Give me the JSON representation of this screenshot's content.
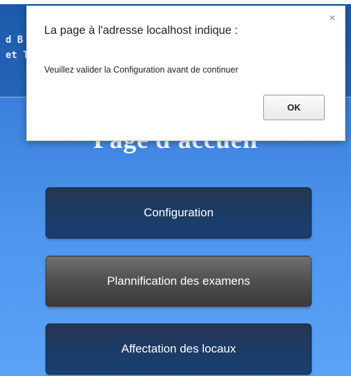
{
  "header": {
    "line1": "d B",
    "line2": "et T"
  },
  "page": {
    "title": "Page d'accueil"
  },
  "menu": {
    "configuration_label": "Configuration",
    "planification_label": "Plannification des examens",
    "affectation_label": "Affectation des locaux"
  },
  "dialog": {
    "title": "La page à l'adresse localhost indique :",
    "message": "Veuillez valider la Configuration avant de continuer",
    "ok_label": "OK",
    "close_glyph": "×"
  },
  "colors": {
    "header_band": "#1d5aa8",
    "page_gradient_top": "#2f6fc9",
    "page_gradient_bottom": "#5aa3f7",
    "button_blue": "#1d3b63",
    "button_gray": "#4f4f4f"
  }
}
